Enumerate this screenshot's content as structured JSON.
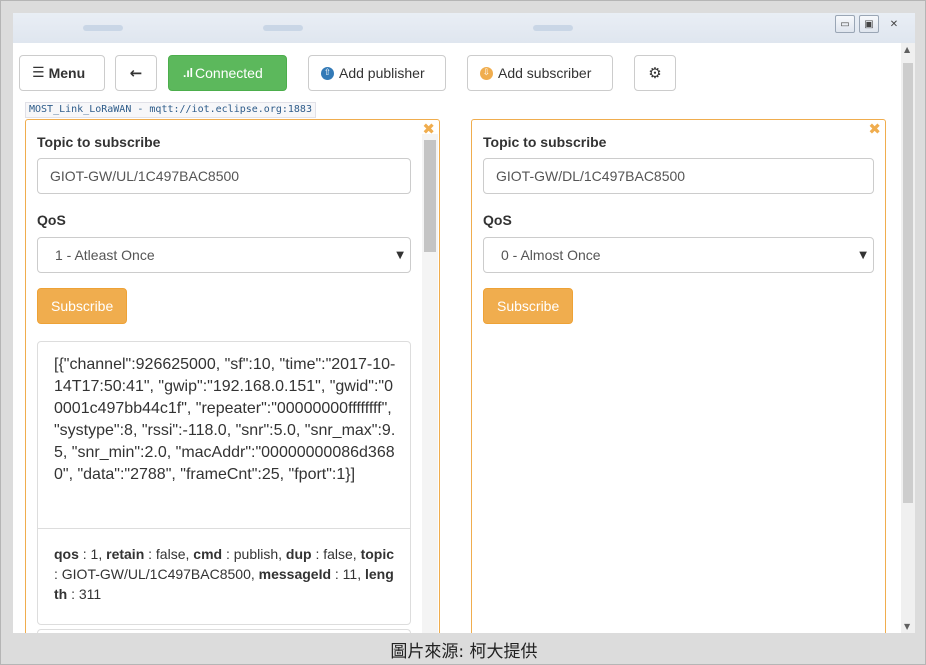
{
  "window": {
    "minimize_glyph": "▭",
    "restore_glyph": "▣",
    "close_glyph": "✕"
  },
  "toolbar": {
    "menu_icon": "☰",
    "menu_label": "Menu",
    "back_icon": "🡐",
    "connected_icon": ".ıl",
    "connected_label": "Connected",
    "add_publisher_icon": "⇧",
    "add_publisher_label": "Add publisher",
    "add_subscriber_icon": "⇩",
    "add_subscriber_label": "Add subscriber",
    "settings_icon": "⚙"
  },
  "connection_url": "MOST_Link_LoRaWAN - mqtt://iot.eclipse.org:1883",
  "panels": [
    {
      "topic_label": "Topic to subscribe",
      "topic_value": "GIOT-GW/UL/1C497BAC8500",
      "qos_label": "QoS",
      "qos_value": "1 - Atleast Once",
      "subscribe_label": "Subscribe",
      "close_icon": "✖",
      "message": {
        "body": "[{\"channel\":926625000, \"sf\":10, \"time\":\"2017-10-14T17:50:41\", \"gwip\":\"192.168.0.151\", \"gwid\":\"00001c497bb44c1f\", \"repeater\":\"00000000ffffffff\", \"systype\":8, \"rssi\":-118.0, \"snr\":5.0, \"snr_max\":9.5, \"snr_min\":2.0, \"macAddr\":\"00000000086d3680\", \"data\":\"2788\", \"frameCnt\":25, \"fport\":1}]",
        "qos_key": "qos",
        "qos_val": " : 1, ",
        "retain_key": "retain",
        "retain_val": " : false, ",
        "cmd_key": "cmd",
        "cmd_val": " : publish, ",
        "dup_key": "dup",
        "dup_val": " : false, ",
        "topic_key": "topic",
        "topic_val": " : GIOT-GW/UL/1C497BAC8500, ",
        "messageid_key": "messageId",
        "messageid_val": " : 11, ",
        "length_key": "length",
        "length_val": " : 311"
      }
    },
    {
      "topic_label": "Topic to subscribe",
      "topic_value": "GIOT-GW/DL/1C497BAC8500",
      "qos_label": "QoS",
      "qos_value": "0 - Almost Once",
      "subscribe_label": "Subscribe",
      "close_icon": "✖"
    }
  ],
  "caption": "圖片來源: 柯大提供"
}
